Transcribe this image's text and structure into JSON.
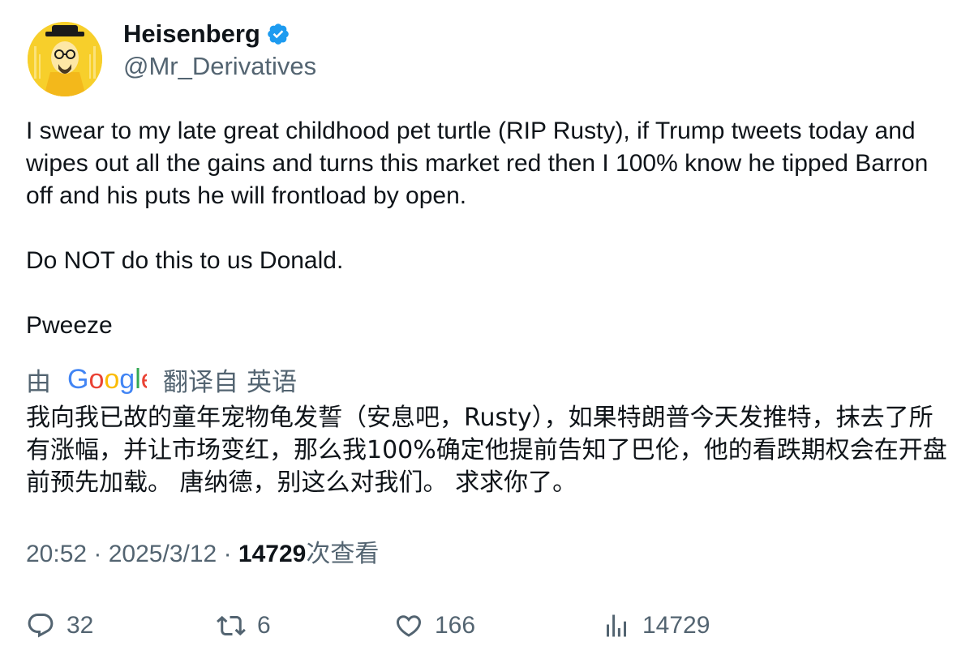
{
  "author": {
    "display_name": "Heisenberg",
    "handle": "@Mr_Derivatives",
    "avatar_icon": "heisenberg-avatar-icon",
    "verified_icon": "verified-badge-icon",
    "verified_color": "#1d9bf0"
  },
  "tweet": {
    "paragraph_1": "I swear to my late great childhood pet turtle (RIP Rusty), if Trump tweets today and wipes out all the gains and turns this market red then I 100% know he tipped Barron off and his puts he will frontload by open.",
    "paragraph_2": "Do NOT do this to us Donald.",
    "paragraph_3": "Pweeze"
  },
  "translation_bar": {
    "prefix": "由",
    "provider_logo": "Google",
    "suffix": "翻译自",
    "source_language": "英语"
  },
  "translation": {
    "text": "我向我已故的童年宠物龟发誓（安息吧，Rusty），如果特朗普今天发推特，抹去了所有涨幅，并让市场变红，那么我100%确定他提前告知了巴伦，他的看跌期权会在开盘前预先加载。 唐纳德，别这么对我们。 求求你了。"
  },
  "meta": {
    "time": "20:52",
    "separator": "·",
    "date": "2025/3/12",
    "views_count": "14729",
    "views_label": "次查看"
  },
  "actions": {
    "replies": "32",
    "retweets": "6",
    "likes": "166",
    "views": "14729"
  },
  "colors": {
    "text_primary": "#0f1419",
    "text_secondary": "#536471",
    "avatar_background": "#f7cf2b"
  }
}
